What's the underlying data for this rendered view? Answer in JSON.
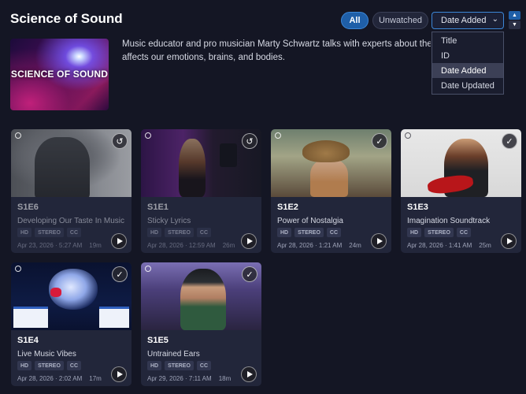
{
  "header": {
    "title": "Science of Sound"
  },
  "filters": {
    "all": "All",
    "unwatched": "Unwatched"
  },
  "sort": {
    "selected": "Date Added",
    "options": [
      "Title",
      "ID",
      "Date Added",
      "Date Updated"
    ],
    "asc_icon": "▲",
    "desc_icon": "▼",
    "chevron_icon": "⌄"
  },
  "show": {
    "art_text": "SCIENCE OF SOUND",
    "description_line1": "Music educator and pro musician Marty Schwartz talks with experts about the scie",
    "description_line2": "affects our emotions, brains, and bodies."
  },
  "episodes": [
    {
      "code": "S1E6",
      "title": "Developing Our Taste In Music",
      "badges": [
        "HD",
        "STEREO",
        "CC"
      ],
      "date": "Apr 23, 2026 · 5:27 AM",
      "duration": "19m",
      "status_icon": "replay-icon",
      "status_glyph": "↺"
    },
    {
      "code": "S1E1",
      "title": "Sticky Lyrics",
      "badges": [
        "HD",
        "STEREO",
        "CC"
      ],
      "date": "Apr 28, 2026 · 12:59 AM",
      "duration": "26m",
      "status_icon": "replay-icon",
      "status_glyph": "↺"
    },
    {
      "code": "S1E2",
      "title": "Power of Nostalgia",
      "badges": [
        "HD",
        "STEREO",
        "CC"
      ],
      "date": "Apr 28, 2026 · 1:21 AM",
      "duration": "24m",
      "status_icon": "check-icon",
      "status_glyph": "✓"
    },
    {
      "code": "S1E3",
      "title": "Imagination Soundtrack",
      "badges": [
        "HD",
        "STEREO",
        "CC"
      ],
      "date": "Apr 28, 2026 · 1:41 AM",
      "duration": "25m",
      "status_icon": "check-icon",
      "status_glyph": "✓"
    },
    {
      "code": "S1E4",
      "title": "Live Music Vibes",
      "badges": [
        "HD",
        "STEREO",
        "CC"
      ],
      "date": "Apr 28, 2026 · 2:02 AM",
      "duration": "17m",
      "status_icon": "check-icon",
      "status_glyph": "✓"
    },
    {
      "code": "S1E5",
      "title": "Untrained Ears",
      "badges": [
        "HD",
        "STEREO",
        "CC"
      ],
      "date": "Apr 29, 2026 · 7:11 AM",
      "duration": "18m",
      "status_icon": "check-icon",
      "status_glyph": "✓"
    }
  ],
  "colors": {
    "background": "#141624",
    "card": "#22263a",
    "accent": "#1f5fa8"
  }
}
